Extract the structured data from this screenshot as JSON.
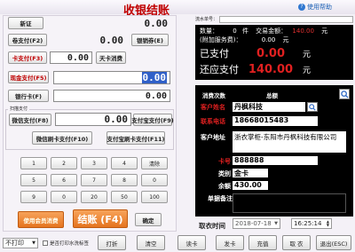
{
  "window": {
    "title": "收银结账",
    "help": "使用帮助"
  },
  "left": {
    "new_label": "新证",
    "new_value": "0.00",
    "apply_label": "卷支付(F2)",
    "apply_value": "0.00",
    "apply_btn": "银销券(E)",
    "card_label": "卡支付(F3)",
    "card_value": "0.00",
    "card_btn": "天卡消费",
    "cash_label": "现金支付(F5)",
    "cash_value": "0.00",
    "bank_label": "银行卡(F)",
    "bank_value": "0.00",
    "scan_title": "扫描支付",
    "wechat_label": "微信支付(F8)",
    "wechat_value": "0.00",
    "alipay_label": "支付宝支付(F9)",
    "wxscan_btn": "微信刷卡支付(F10)",
    "aliscan_btn": "支付宝刷卡支付(F11)"
  },
  "keypad": [
    "1",
    "2",
    "3",
    "4",
    "清除",
    "5",
    "6",
    "7",
    "8",
    "0",
    "9",
    "0",
    "20",
    "50",
    "100"
  ],
  "actions": {
    "member": "使用会员消费",
    "checkout": "结账 (F4)",
    "confirm": "确定"
  },
  "summary": {
    "prefix": "流水单号：",
    "qty_label": "数量：",
    "qty_value": "0",
    "qty_unit": "件",
    "amount_label": "交易金额：",
    "amount_value": "140.00",
    "amount_unit": "元",
    "extra_label": "(附加服务费)：",
    "extra_value": "0.00",
    "extra_unit": "元",
    "paid_label": "已支付",
    "paid_value": "0.00",
    "paid_unit": "元",
    "due_label": "还应支付",
    "due_value": "140.00",
    "due_unit": "元"
  },
  "customer": {
    "visits_label": "消费次数",
    "total_label": "总额",
    "name_label": "客户姓名",
    "name_value": "丹枫科技",
    "phone_label": "联系电话",
    "phone_value": "18668015483",
    "address_label": "客户地址",
    "address_value": "浙衣掌柜-东阳市丹枫科技有限公司",
    "card_label": "卡号",
    "card_value": "888888",
    "type_label": "类别",
    "type_value": "金卡",
    "balance_label": "余额",
    "balance_value": "430.00",
    "note_label": "单据备注"
  },
  "pickup": {
    "label": "取衣时间",
    "date": "2018-07-18",
    "time": "16:25:14"
  },
  "bottom": {
    "print_select": "不打印",
    "label_check": "是否打印水洗标签",
    "buttons": [
      "打折",
      "清空",
      "读卡",
      "发卡",
      "充值",
      "取 衣",
      "退出(ESC)"
    ]
  }
}
